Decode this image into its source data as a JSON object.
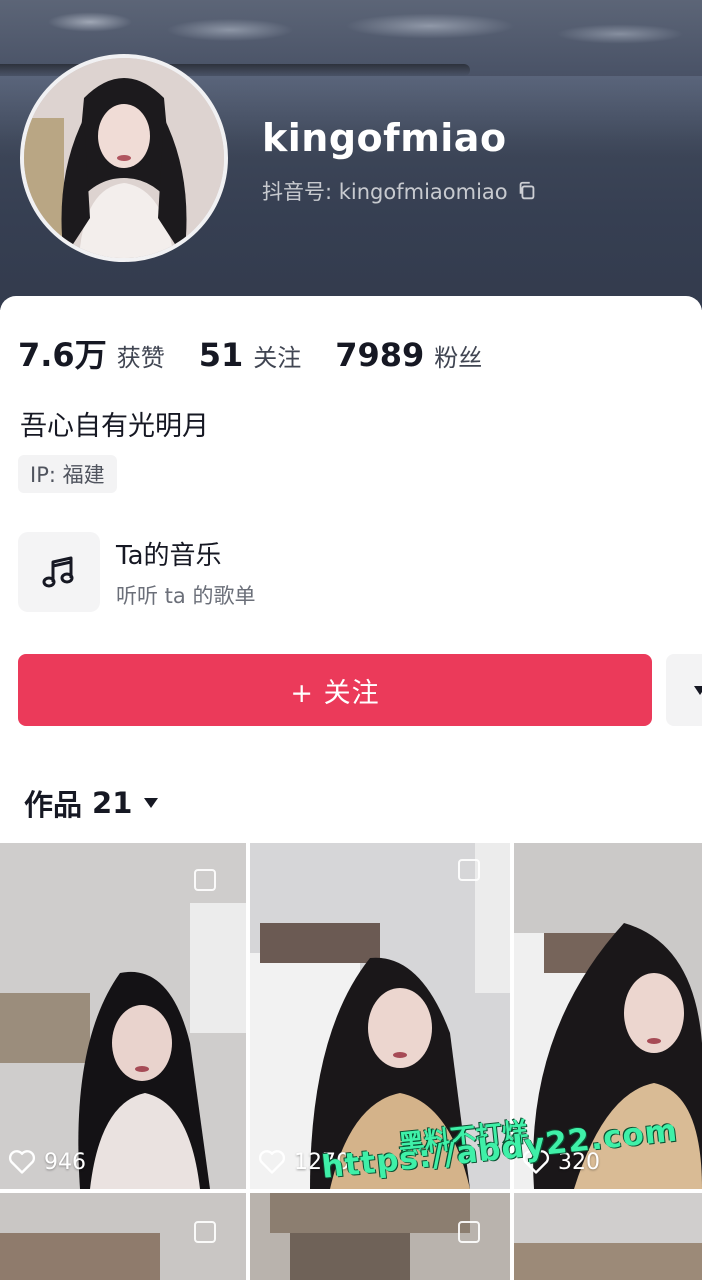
{
  "profile": {
    "username": "kingofmiao",
    "douyin_id": "抖音号: kingofmiaomiao",
    "bio": "吾心自有光明月",
    "ip_location": "IP:  福建"
  },
  "stats": [
    {
      "value": "7.6万",
      "label": "获赞"
    },
    {
      "value": "51",
      "label": "关注"
    },
    {
      "value": "7989",
      "label": "粉丝"
    }
  ],
  "music": {
    "title": "Ta的音乐",
    "subtitle": "听听 ta 的歌单"
  },
  "actions": {
    "follow_label": "+ 关注"
  },
  "works": {
    "tab_label": "作品",
    "count": "21",
    "videos": [
      {
        "likes": "946",
        "pinned": true
      },
      {
        "likes": "1270",
        "pinned": true
      },
      {
        "likes": "320",
        "pinned": false
      },
      {
        "likes": "",
        "pinned": true
      },
      {
        "likes": "",
        "pinned": true
      },
      {
        "likes": "",
        "pinned": false
      }
    ]
  },
  "watermark": {
    "line1": "黑料不打烊",
    "line2": "https://abdy22.com"
  },
  "colors": {
    "follow_button": "#eb3a5a",
    "banner": "#3d4658",
    "watermark": "#3ff0a8"
  },
  "icons": [
    "copy-icon",
    "music-note-icon",
    "heart-icon",
    "chevron-down-icon",
    "pin-icon"
  ]
}
